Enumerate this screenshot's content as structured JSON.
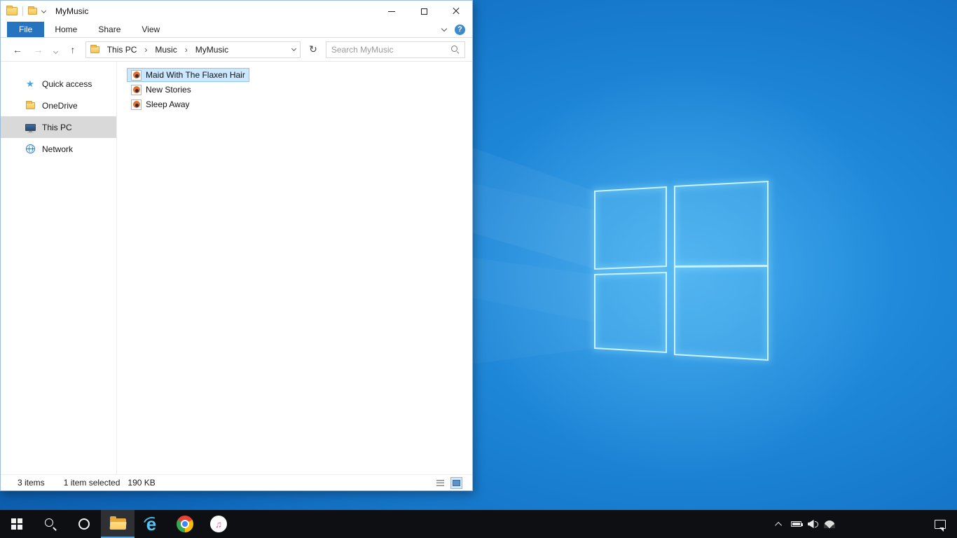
{
  "window": {
    "title": "MyMusic",
    "ribbon": {
      "tabs": [
        {
          "label": "File",
          "active": true
        },
        {
          "label": "Home",
          "active": false
        },
        {
          "label": "Share",
          "active": false
        },
        {
          "label": "View",
          "active": false
        }
      ],
      "help_label": "?"
    },
    "addressbar": {
      "breadcrumb": [
        "This PC",
        "Music",
        "MyMusic"
      ],
      "search_placeholder": "Search MyMusic"
    },
    "sidebar": {
      "items": [
        {
          "label": "Quick access",
          "icon": "star-icon",
          "selected": false
        },
        {
          "label": "OneDrive",
          "icon": "folder-icon",
          "selected": false
        },
        {
          "label": "This PC",
          "icon": "monitor-icon",
          "selected": true
        },
        {
          "label": "Network",
          "icon": "network-icon",
          "selected": false
        }
      ]
    },
    "files": [
      {
        "name": "Maid With The Flaxen Hair",
        "icon": "audio-file-icon",
        "selected": true
      },
      {
        "name": "New Stories",
        "icon": "audio-file-icon",
        "selected": false
      },
      {
        "name": "Sleep Away",
        "icon": "audio-file-icon",
        "selected": false
      }
    ],
    "statusbar": {
      "count": "3 items",
      "selected": "1 item selected",
      "size": "190 KB"
    }
  },
  "icons": {
    "back": "←",
    "forward": "→",
    "up": "↑",
    "refresh": "↻",
    "star": "★"
  },
  "taskbar": {
    "items": [
      "start",
      "search",
      "cortana",
      "file-explorer",
      "internet-explorer",
      "chrome",
      "itunes"
    ],
    "active_item": "file-explorer",
    "tray": [
      "show-hidden-icons",
      "battery",
      "volume",
      "wifi"
    ],
    "action_center": "action-center",
    "ie_letter": "e",
    "itunes_note": "♫"
  },
  "colors": {
    "file_tab": "#2673bf",
    "selection_bg": "#cce8ff",
    "sidebar_selection": "#d9d9d9",
    "taskbar_bg": "#0d0f12",
    "wallpaper_base": "#1272c8",
    "logo_stroke": "#c9f2ff"
  }
}
